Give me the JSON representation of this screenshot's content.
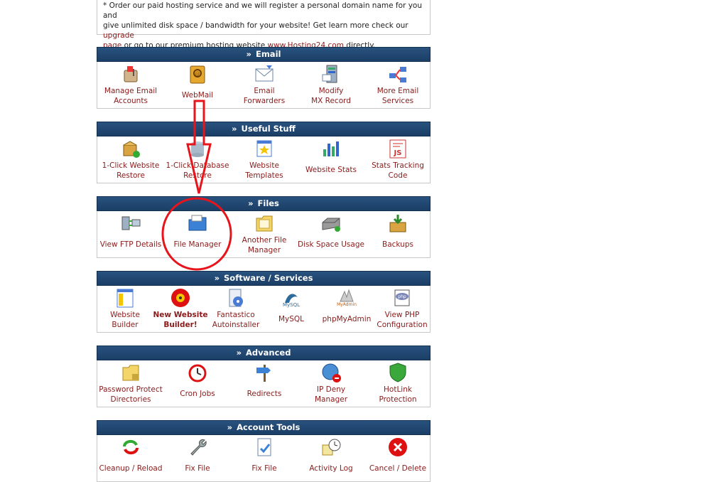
{
  "notice": {
    "line1": "* Order our paid hosting service and we will register a personal domain name for you and",
    "line2": "give unlimited disk space / bandwidth for your website! Get learn more check our ",
    "link1": "upgrade",
    "link1b": "page",
    "mid": " or go to our premium hosting website ",
    "link2": "www.Hosting24.com",
    "end": " directly."
  },
  "panels": [
    {
      "title": "Email",
      "items": [
        {
          "l1": "Manage Email",
          "l2": "Accounts",
          "icon": "mailbox-icon"
        },
        {
          "l1": "WebMail",
          "l2": "",
          "icon": "address-book-icon"
        },
        {
          "l1": "Email",
          "l2": "Forwarders",
          "icon": "envelope-icon"
        },
        {
          "l1": "Modify",
          "l2": "MX Record",
          "icon": "server-mail-icon"
        },
        {
          "l1": "More Email",
          "l2": "Services",
          "icon": "network-icon"
        }
      ]
    },
    {
      "title": "Useful Stuff",
      "items": [
        {
          "l1": "1-Click Website",
          "l2": "Restore",
          "icon": "box-restore-icon"
        },
        {
          "l1": "1-Click Database",
          "l2": "Restore",
          "icon": "database-restore-icon"
        },
        {
          "l1": "Website",
          "l2": "Templates",
          "icon": "template-star-icon"
        },
        {
          "l1": "Website Stats",
          "l2": "",
          "icon": "bar-chart-icon"
        },
        {
          "l1": "Stats Tracking",
          "l2": "Code",
          "icon": "js-code-icon"
        }
      ]
    },
    {
      "title": "Files",
      "items": [
        {
          "l1": "View FTP Details",
          "l2": "",
          "icon": "ftp-icon"
        },
        {
          "l1": "File Manager",
          "l2": "",
          "icon": "file-manager-icon"
        },
        {
          "l1": "Another File",
          "l2": "Manager",
          "icon": "folder-icon"
        },
        {
          "l1": "Disk Space Usage",
          "l2": "",
          "icon": "hard-disk-icon"
        },
        {
          "l1": "Backups",
          "l2": "",
          "icon": "backup-box-icon"
        }
      ]
    },
    {
      "title": "Software / Services",
      "items": [
        {
          "l1": "Website",
          "l2": "Builder",
          "icon": "builder-window-icon"
        },
        {
          "l1": "New Website",
          "l2": "Builder!",
          "icon": "red-disc-icon",
          "bold": true
        },
        {
          "l1": "Fantastico",
          "l2": "Autoinstaller",
          "icon": "installer-icon"
        },
        {
          "l1": "MySQL",
          "l2": "",
          "icon": "mysql-icon"
        },
        {
          "l1": "phpMyAdmin",
          "l2": "",
          "icon": "phpmyadmin-icon"
        },
        {
          "l1": "View PHP",
          "l2": "Configuration",
          "icon": "php-icon"
        }
      ]
    },
    {
      "title": "Advanced",
      "items": [
        {
          "l1": "Password Protect",
          "l2": "Directories",
          "icon": "lock-folder-icon"
        },
        {
          "l1": "Cron Jobs",
          "l2": "",
          "icon": "alarm-clock-icon"
        },
        {
          "l1": "Redirects",
          "l2": "",
          "icon": "signpost-icon"
        },
        {
          "l1": "IP Deny",
          "l2": "Manager",
          "icon": "globe-deny-icon"
        },
        {
          "l1": "HotLink",
          "l2": "Protection",
          "icon": "shield-icon"
        }
      ]
    },
    {
      "title": "Account Tools",
      "items": [
        {
          "l1": "Cleanup / Reload",
          "l2": "",
          "icon": "reload-arrows-icon"
        },
        {
          "l1": "Fix File",
          "l2": "",
          "icon": "wrench-icon"
        },
        {
          "l1": "Fix File",
          "l2": "",
          "icon": "document-check-icon"
        },
        {
          "l1": "Activity Log",
          "l2": "",
          "icon": "clock-log-icon"
        },
        {
          "l1": "Cancel / Delete",
          "l2": "",
          "icon": "cancel-icon"
        }
      ]
    }
  ]
}
